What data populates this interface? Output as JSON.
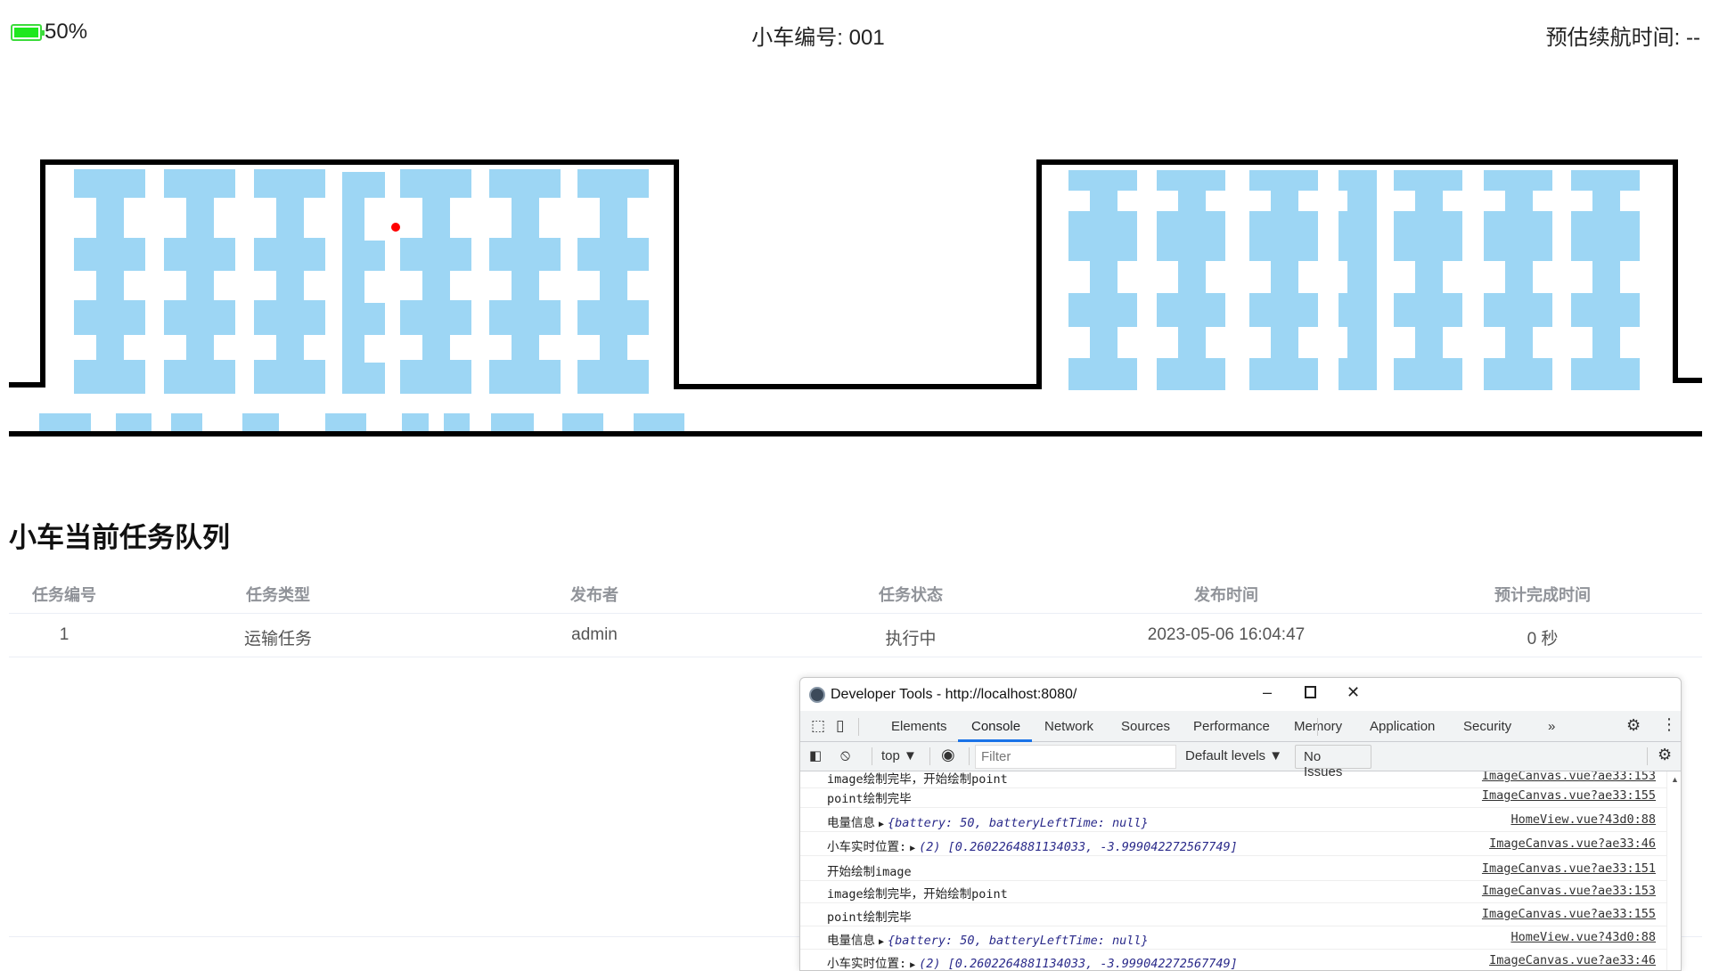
{
  "header": {
    "battery_percent": 50,
    "battery_label": "50%",
    "battery_color": "#1ee81e",
    "car_id": "小车编号: 001",
    "remaining_time": "预估续航时间: --"
  },
  "map": {
    "shelf_color": "#9dd6f4",
    "wall_color": "#000000",
    "car_marker_color": "#ff0000"
  },
  "tasks": {
    "title": "小车当前任务队列",
    "columns": [
      "任务编号",
      "任务类型",
      "发布者",
      "任务状态",
      "发布时间",
      "预计完成时间"
    ],
    "rows": [
      [
        "1",
        "运输任务",
        "admin",
        "执行中",
        "2023-05-06 16:04:47",
        "0 秒"
      ]
    ]
  },
  "devtools": {
    "title": "Developer Tools - http://localhost:8080/",
    "tabs": [
      "Elements",
      "Console",
      "Network",
      "Sources",
      "Performance",
      "Memory",
      "Application",
      "Security",
      "»"
    ],
    "active_tab": "Console",
    "context": "top ▼",
    "filter_placeholder": "Filter",
    "levels": "Default levels ▼",
    "issues": "No Issues",
    "logs": [
      {
        "msg": "image绘制完毕，开始绘制point",
        "src": "ImageCanvas.vue?ae33:153"
      },
      {
        "msg": "point绘制完毕",
        "src": "ImageCanvas.vue?ae33:155"
      },
      {
        "label": "电量信息",
        "obj": "{battery: 50, batteryLeftTime: null}",
        "src": "HomeView.vue?43d0:88"
      },
      {
        "label": "小车实时位置:",
        "obj": "(2) [0.2602264881134033, -3.999042272567749]",
        "src": "ImageCanvas.vue?ae33:46"
      },
      {
        "msg": "开始绘制image",
        "src": "ImageCanvas.vue?ae33:151"
      },
      {
        "msg": "image绘制完毕，开始绘制point",
        "src": "ImageCanvas.vue?ae33:153"
      },
      {
        "msg": "point绘制完毕",
        "src": "ImageCanvas.vue?ae33:155"
      },
      {
        "label": "电量信息",
        "obj": "{battery: 50, batteryLeftTime: null}",
        "src": "HomeView.vue?43d0:88"
      },
      {
        "label": "小车实时位置:",
        "obj": "(2) [0.2602264881134033, -3.999042272567749]",
        "src": "ImageCanvas.vue?ae33:46"
      }
    ]
  }
}
